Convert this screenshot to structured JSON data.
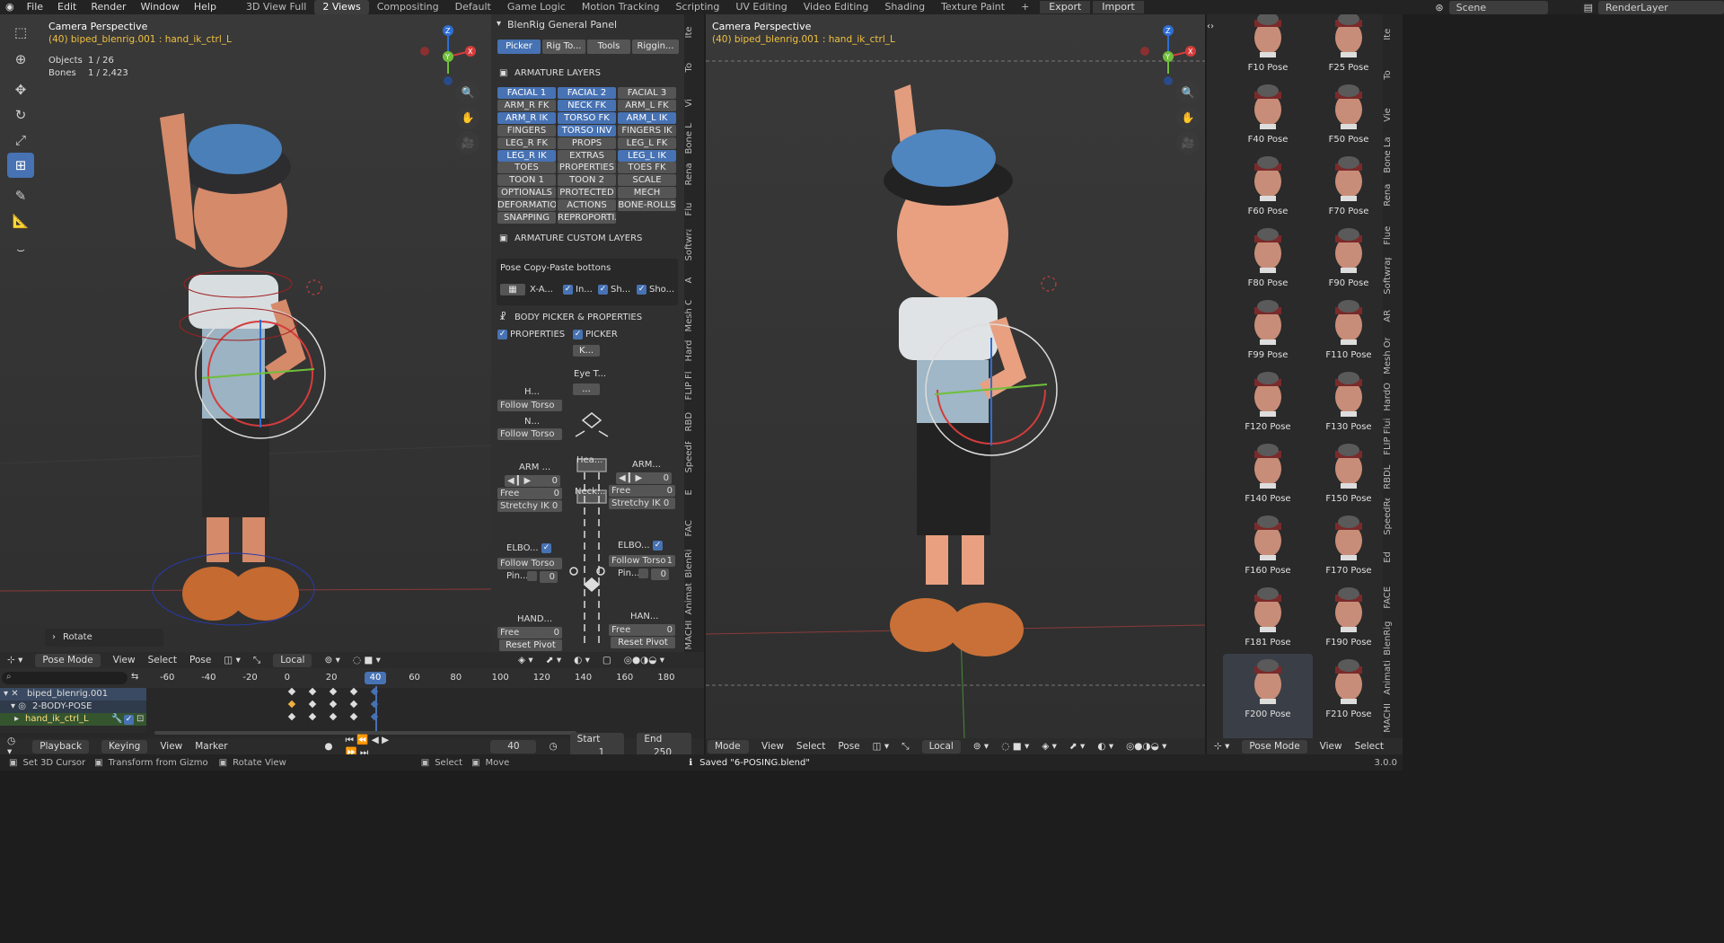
{
  "topbar": {
    "menus": [
      "File",
      "Edit",
      "Render",
      "Window",
      "Help"
    ],
    "workspaces": [
      "3D View Full",
      "2 Views",
      "Compositing",
      "Default",
      "Game Logic",
      "Motion Tracking",
      "Scripting",
      "UV Editing",
      "Video Editing",
      "Shading",
      "Texture Paint"
    ],
    "active_workspace": "2 Views",
    "add": "+",
    "export": "Export",
    "import": "Import",
    "scene": "Scene",
    "render_layer": "RenderLayer"
  },
  "left_viewport": {
    "title": "Camera Perspective",
    "subtitle": "(40) biped_blenrig.001 : hand_ik_ctrl_L",
    "objects_label": "Objects",
    "objects_value": "1 / 26",
    "bones_label": "Bones",
    "bones_value": "1 / 2,423",
    "rotate_label": "Rotate",
    "header": {
      "mode": "Pose Mode",
      "view": "View",
      "select": "Select",
      "pose": "Pose",
      "orientation": "Local"
    }
  },
  "right_viewport": {
    "title": "Camera Perspective",
    "subtitle": "(40) biped_blenrig.001 : hand_ik_ctrl_L",
    "header": {
      "mode": "Mode",
      "view": "View",
      "select": "Select",
      "pose": "Pose",
      "orientation": "Local"
    }
  },
  "blenrig": {
    "panel_title": "BlenRig General Panel",
    "tabs": [
      "Picker",
      "Rig To...",
      "Tools",
      "Riggin..."
    ],
    "armature_layers": "ARMATURE LAYERS",
    "layers": [
      {
        "label": "FACIAL 1",
        "on": true
      },
      {
        "label": "FACIAL 2",
        "on": true
      },
      {
        "label": "FACIAL 3",
        "on": false
      },
      {
        "label": "ARM_R FK",
        "on": false
      },
      {
        "label": "NECK FK",
        "on": true
      },
      {
        "label": "ARM_L FK",
        "on": false
      },
      {
        "label": "ARM_R IK",
        "on": true
      },
      {
        "label": "TORSO FK",
        "on": true
      },
      {
        "label": "ARM_L IK",
        "on": true
      },
      {
        "label": "FINGERS",
        "on": false
      },
      {
        "label": "TORSO INV",
        "on": true
      },
      {
        "label": "FINGERS IK",
        "on": false
      },
      {
        "label": "LEG_R FK",
        "on": false
      },
      {
        "label": "PROPS",
        "on": false
      },
      {
        "label": "LEG_L FK",
        "on": false
      },
      {
        "label": "LEG_R IK",
        "on": true
      },
      {
        "label": "EXTRAS",
        "on": false
      },
      {
        "label": "LEG_L IK",
        "on": true
      },
      {
        "label": "TOES",
        "on": false
      },
      {
        "label": "PROPERTIES",
        "on": false
      },
      {
        "label": "TOES FK",
        "on": false
      },
      {
        "label": "TOON 1",
        "on": false
      },
      {
        "label": "TOON 2",
        "on": false
      },
      {
        "label": "SCALE",
        "on": false
      },
      {
        "label": "OPTIONALS",
        "on": false
      },
      {
        "label": "PROTECTED",
        "on": false
      },
      {
        "label": "MECH",
        "on": false
      },
      {
        "label": "DEFORMATION",
        "on": false
      },
      {
        "label": "ACTIONS",
        "on": false
      },
      {
        "label": "BONE-ROLLS",
        "on": false
      },
      {
        "label": "SNAPPING",
        "on": false
      },
      {
        "label": "REPROPORTI...",
        "on": false
      }
    ],
    "custom_layers": "ARMATURE CUSTOM LAYERS",
    "copy_paste": "Pose Copy-Paste bottons",
    "xa": "X-A...",
    "in": "In...",
    "sh": "Sh...",
    "sho": "Sho...",
    "body_picker": "BODY PICKER & PROPERTIES",
    "properties": "PROPERTIES",
    "picker": "PICKER",
    "k": "K...",
    "eye_t": "Eye T...",
    "dots": "...",
    "h": "H...",
    "n": "N...",
    "follow_torso": "Follow Torso",
    "one": "1",
    "zero": "0",
    "hea": "Hea...",
    "neck": "Neck...",
    "arm_l": "ARM ...",
    "arm_r": "ARM...",
    "free": "Free",
    "stretchy": "Stretchy IK",
    "elbo_l": "ELBO...",
    "elbo_r": "ELBO...",
    "pin": "Pin...",
    "hand_l": "HAND...",
    "hand_r": "HAN...",
    "reset_pivot": "Reset Pivot",
    "side_tabs": [
      "Ite",
      "To",
      "Vi",
      "Bone La",
      "Rena",
      "Flu",
      "Softwra",
      "A",
      "Mesh On",
      "Hard",
      "FLIP Fl",
      "RBD",
      "SpeedRet",
      "E",
      "FAC",
      "BlenRi",
      "Animat",
      "MACHI"
    ]
  },
  "poses": {
    "items": [
      "F10 Pose",
      "F25 Pose",
      "F40 Pose",
      "F50 Pose",
      "F60 Pose",
      "F70 Pose",
      "F80 Pose",
      "F90 Pose",
      "F99 Pose",
      "F110 Pose",
      "F120 Pose",
      "F130 Pose",
      "F140 Pose",
      "F150 Pose",
      "F160 Pose",
      "F170 Pose",
      "F181 Pose",
      "F190 Pose",
      "F200 Pose",
      "F210 Pose"
    ],
    "selected": "F200 Pose",
    "side_tabs": [
      "Ite",
      "To",
      "Vie",
      "Bone Laye",
      "Rena",
      "Flue",
      "Softwrap",
      "AR",
      "Mesh Onl",
      "HardO",
      "FLIP Flui",
      "RBDL",
      "SpeedReto",
      "Ed",
      "FACE",
      "BlenRig",
      "Animati",
      "MACHI"
    ],
    "header": {
      "mode": "Pose Mode",
      "view": "View",
      "select": "Select"
    }
  },
  "timeline": {
    "ruler": [
      "-60",
      "-40",
      "-20",
      "0",
      "20",
      "40",
      "60",
      "80",
      "100",
      "120",
      "140",
      "160",
      "180"
    ],
    "current": "40",
    "tracks": [
      "biped_blenrig.001",
      "2-BODY-POSE",
      "hand_ik_ctrl_L"
    ],
    "controls": {
      "playback": "Playback",
      "keying": "Keying",
      "view": "View",
      "marker": "Marker",
      "frame": "40",
      "start_label": "Start",
      "start": "1",
      "end_label": "End",
      "end": "250"
    }
  },
  "statusbar": {
    "set_cursor": "Set 3D Cursor",
    "transform": "Transform from Gizmo",
    "rotate_view": "Rotate View",
    "select": "Select",
    "move": "Move",
    "saved": "Saved \"6-POSING.blend\"",
    "version": "3.0.0"
  },
  "colors": {
    "accent": "#4772b3",
    "keyframe": "#f0b040",
    "playhead": "#4772b3"
  }
}
